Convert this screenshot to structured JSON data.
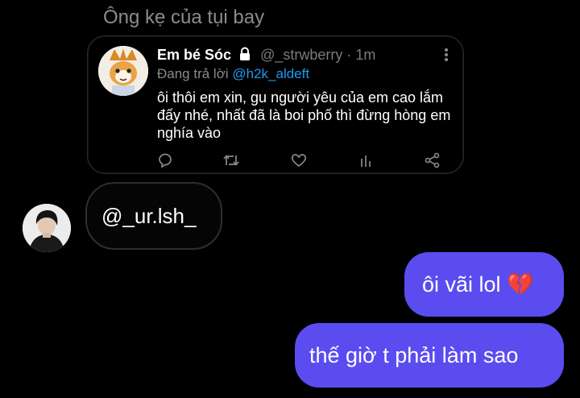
{
  "chat": {
    "header_text": "Ông kẹ của tụi bay",
    "quoted_tweet": {
      "display_name": "Em bé Sóc",
      "handle": "@_strwberry",
      "separator": "·",
      "time": "1m",
      "replying_prefix": "Đang trả lời",
      "replying_to": "@h2k_aldeft",
      "body": "ôi thôi em xin, gu người yêu của em cao lắm đấy nhé, nhất đã là boi phố thì đừng hòng em nghía vào"
    },
    "incoming_message": {
      "text": "@_ur.lsh_"
    },
    "outgoing_messages": [
      {
        "text": "ôi vãi lol 💔"
      },
      {
        "text": "thế giờ t phải làm sao"
      }
    ],
    "colors": {
      "background": "#000000",
      "outgoing_bubble": "#5b4cf0",
      "mention_blue": "#1d9bf0",
      "muted_text": "#8a8a8a"
    }
  }
}
